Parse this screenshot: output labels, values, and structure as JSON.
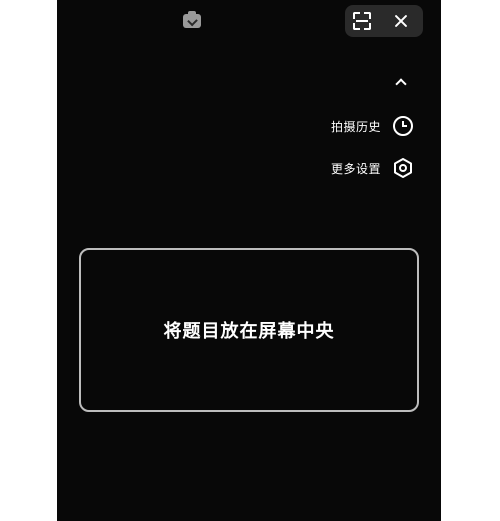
{
  "menu": {
    "history_label": "拍摄历史",
    "settings_label": "更多设置"
  },
  "frame": {
    "hint": "将题目放在屏幕中央"
  },
  "icons": {
    "top_status": "camera-check-icon",
    "scan": "scan-icon",
    "close": "close-icon",
    "collapse": "chevron-up-icon",
    "history": "clock-icon",
    "settings": "gear-icon"
  },
  "colors": {
    "background": "#080808",
    "pill": "#2a2a2a",
    "frame_border": "#bdbdbd",
    "text": "#ffffff"
  }
}
